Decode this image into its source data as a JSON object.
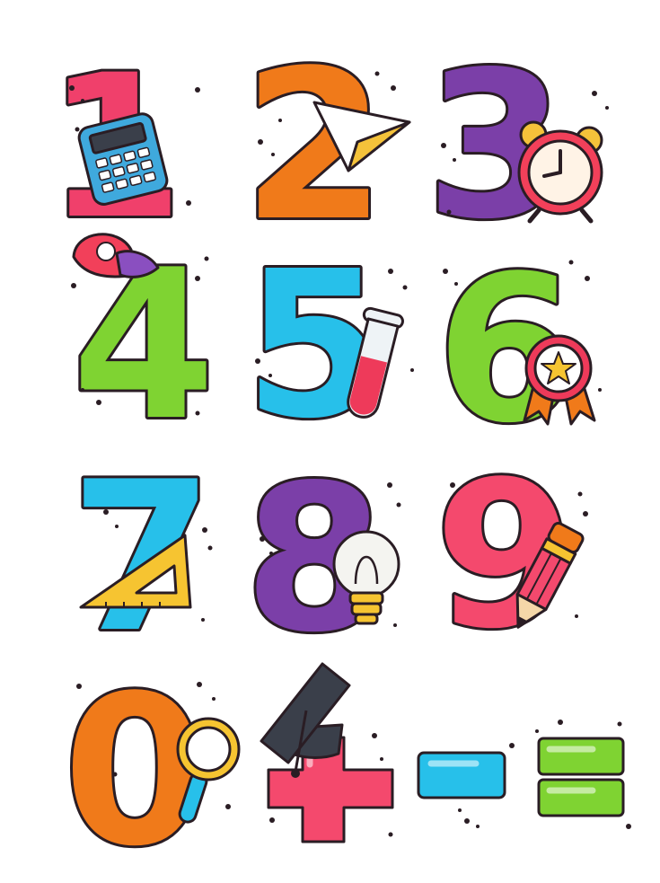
{
  "sheet": {
    "digits": [
      {
        "char": "1",
        "color": "#f0406b",
        "prop": "calculator-icon"
      },
      {
        "char": "2",
        "color": "#f07a1a",
        "prop": "paper-plane-icon"
      },
      {
        "char": "3",
        "color": "#7b3fa8",
        "prop": "alarm-clock-icon"
      },
      {
        "char": "4",
        "color": "#7fd332",
        "prop": "cap-icon"
      },
      {
        "char": "5",
        "color": "#27c0ea",
        "prop": "test-tube-icon"
      },
      {
        "char": "6",
        "color": "#7fd332",
        "prop": "star-medal-icon"
      },
      {
        "char": "7",
        "color": "#27c0ea",
        "prop": "set-square-icon"
      },
      {
        "char": "8",
        "color": "#7b3fa8",
        "prop": "light-bulb-icon"
      },
      {
        "char": "9",
        "color": "#f4496d",
        "prop": "pencil-icon"
      },
      {
        "char": "0",
        "color": "#f07a1a",
        "prop": "magnifier-icon"
      }
    ],
    "operators": [
      {
        "name": "plus",
        "color": "#f4496d",
        "prop": "graduation-cap-icon"
      },
      {
        "name": "minus",
        "color": "#27c0ea"
      },
      {
        "name": "equals",
        "color": "#7fd332"
      }
    ],
    "colors": {
      "outline": "#2a1d24",
      "background": "#ffffff"
    }
  }
}
